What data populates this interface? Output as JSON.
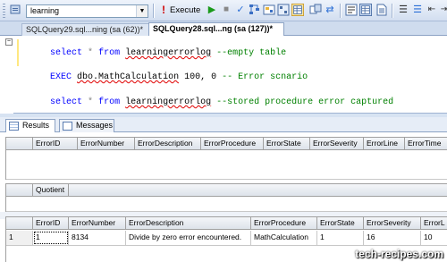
{
  "toolbar": {
    "database": "learning",
    "execute_label": "Execute"
  },
  "tabs": [
    {
      "label": "SQLQuery29.sql...ning (sa (62))*"
    },
    {
      "label": "SQLQuery28.sql...ng (sa (127))*"
    }
  ],
  "editor": {
    "lines": [
      {
        "kw1": "select",
        "op": "*",
        "kw2": "from",
        "obj": "learningerrorlog",
        "comment": "--empty table"
      },
      {
        "kw1": "EXEC",
        "obj": "dbo.MathCalculation",
        "args": "100, 0",
        "comment": "-- Error scnario"
      },
      {
        "kw1": "select",
        "op": "*",
        "kw2": "from",
        "obj": "learningerrorlog",
        "comment": "--stored procedure error captured"
      }
    ]
  },
  "results_tabs": [
    {
      "label": "Results"
    },
    {
      "label": "Messages"
    }
  ],
  "grid1": {
    "columns": [
      "ErrorID",
      "ErrorNumber",
      "ErrorDescription",
      "ErrorProcedure",
      "ErrorState",
      "ErrorSeverity",
      "ErrorLine",
      "ErrorTime"
    ]
  },
  "grid2": {
    "columns": [
      "Quotient"
    ]
  },
  "grid3": {
    "columns": [
      "ErrorID",
      "ErrorNumber",
      "ErrorDescription",
      "ErrorProcedure",
      "ErrorState",
      "ErrorSeverity",
      "ErrorL"
    ],
    "rows": [
      {
        "num": "1",
        "cells": [
          "1",
          "8134",
          "Divide by zero error encountered.",
          "MathCalculation",
          "1",
          "16",
          "10"
        ]
      }
    ]
  },
  "watermark": "tech-recipes.com",
  "colors": {
    "keyword": "#0000ff",
    "comment": "#008000",
    "operator": "#808080",
    "toolbar_bg": "#d7e3f2"
  }
}
